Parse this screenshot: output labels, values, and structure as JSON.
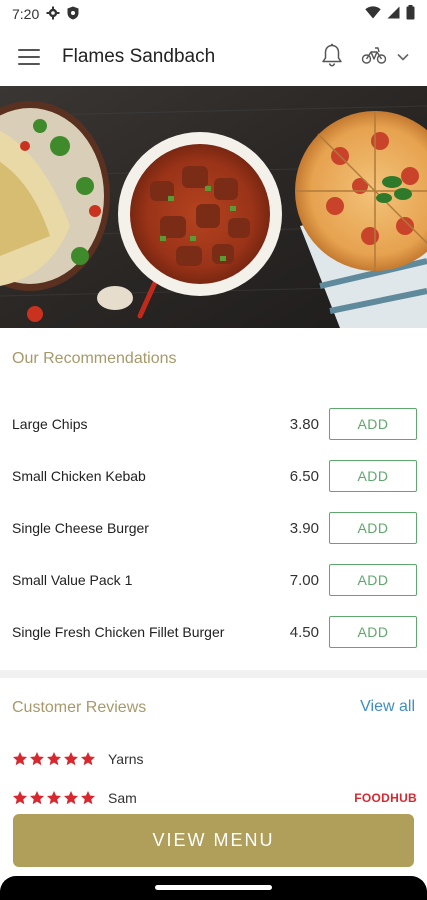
{
  "status_bar": {
    "time": "7:20",
    "left_icons": [
      "settings-icon",
      "shield-icon"
    ],
    "right_icons": [
      "wifi-icon",
      "signal-icon",
      "battery-icon"
    ]
  },
  "header": {
    "title": "Flames Sandbach",
    "icons": [
      "menu-icon",
      "bell-icon",
      "bike-icon",
      "chevron-down-icon"
    ]
  },
  "hero": {
    "image": "food-banner"
  },
  "recommendations": {
    "title": "Our Recommendations",
    "items": [
      {
        "name": "Large Chips",
        "price": "3.80",
        "button": "ADD"
      },
      {
        "name": "Small Chicken Kebab",
        "price": "6.50",
        "button": "ADD"
      },
      {
        "name": "Single Cheese Burger",
        "price": "3.90",
        "button": "ADD"
      },
      {
        "name": "Small Value Pack 1",
        "price": "7.00",
        "button": "ADD"
      },
      {
        "name": "Single Fresh Chicken Fillet Burger",
        "price": "4.50",
        "button": "ADD"
      }
    ]
  },
  "reviews": {
    "title": "Customer Reviews",
    "view_all": "View all",
    "items": [
      {
        "rating": 5,
        "reviewer": "Yarns",
        "source": ""
      },
      {
        "rating": 5,
        "reviewer": "Sam",
        "source": "FOODHUB"
      }
    ]
  },
  "cta": {
    "label": "VIEW MENU"
  },
  "colors": {
    "accent_gold": "#b09e5b",
    "section_title": "#a8996a",
    "add_green": "#5fa86d",
    "link_blue": "#3d8ec4",
    "star_red": "#d8282f"
  }
}
